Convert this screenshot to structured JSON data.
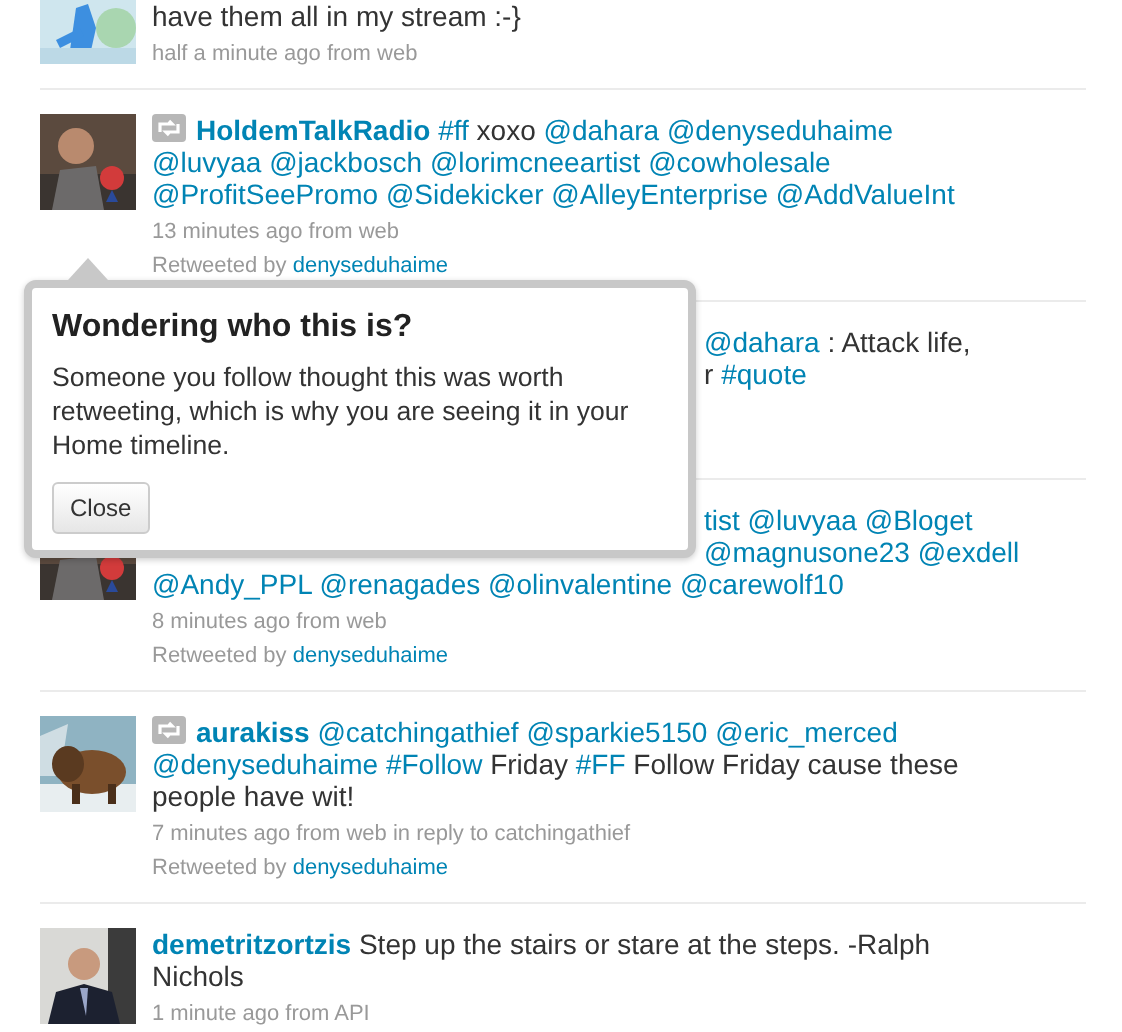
{
  "tweets": [
    {
      "kind": "full",
      "avatar": {
        "kind": "picture",
        "cut_top": true
      },
      "retweet": false,
      "segments": [
        {
          "kind": "plain",
          "text": "have them all in my stream :-}"
        }
      ],
      "meta": "half a minute ago from web"
    },
    {
      "kind": "full",
      "avatar": {
        "kind": "picture"
      },
      "retweet": true,
      "segments": [
        {
          "kind": "user",
          "text": "HoldemTalkRadio"
        },
        {
          "kind": "hashtag",
          "text": "#ff"
        },
        {
          "kind": "plain",
          "text": "xoxo"
        },
        {
          "kind": "mention",
          "text": "@dahara"
        },
        {
          "kind": "mention",
          "text": "@denyseduhaime"
        },
        {
          "kind": "mention",
          "text": "@luvyaa"
        },
        {
          "kind": "mention",
          "text": "@jackbosch"
        },
        {
          "kind": "mention",
          "text": "@lorimcneeartist"
        },
        {
          "kind": "mention",
          "text": "@cowholesale"
        },
        {
          "kind": "mention",
          "text": "@ProfitSeePromo"
        },
        {
          "kind": "mention",
          "text": "@Sidekicker"
        },
        {
          "kind": "mention",
          "text": "@AlleyEnterprise"
        },
        {
          "kind": "mention",
          "text": "@AddValueInt"
        }
      ],
      "meta": "13 minutes ago from web",
      "retweeted_by": {
        "label": "Retweeted by",
        "user": "denyseduhaime"
      }
    },
    {
      "kind": "obscured",
      "lines": [
        {
          "kind": "clipped",
          "segments": [
            {
              "kind": "mention",
              "text": "@dahara"
            },
            {
              "kind": "plain",
              "text": ": Attack life,"
            }
          ]
        },
        {
          "kind": "clipped",
          "segments": [
            {
              "kind": "plain",
              "text": "r"
            },
            {
              "kind": "hashtag",
              "text": "#quote"
            }
          ]
        }
      ]
    },
    {
      "kind": "obscured",
      "avatar": {
        "kind": "picture"
      },
      "lines": [
        {
          "kind": "clipped",
          "segments": [
            {
              "kind": "mention",
              "text": "tist"
            },
            {
              "kind": "mention",
              "text": "@luvyaa"
            },
            {
              "kind": "mention",
              "text": "@Bloget"
            }
          ]
        },
        {
          "kind": "clipped",
          "segments": [
            {
              "kind": "mention",
              "text": "@magnusone23"
            },
            {
              "kind": "mention",
              "text": "@exdell"
            }
          ]
        },
        {
          "kind": "whole",
          "segments": [
            {
              "kind": "mention",
              "text": "@Andy_PPL"
            },
            {
              "kind": "mention",
              "text": "@renagades"
            },
            {
              "kind": "mention",
              "text": "@olinvalentine"
            },
            {
              "kind": "mention",
              "text": "@carewolf10"
            }
          ]
        }
      ],
      "meta": "8 minutes ago from web",
      "retweeted_by": {
        "label": "Retweeted by",
        "user": "denyseduhaime"
      }
    },
    {
      "kind": "full",
      "avatar": {
        "kind": "picture"
      },
      "retweet": true,
      "segments": [
        {
          "kind": "user",
          "text": "aurakiss"
        },
        {
          "kind": "mention",
          "text": "@catchingathief"
        },
        {
          "kind": "mention",
          "text": "@sparkie5150"
        },
        {
          "kind": "mention",
          "text": "@eric_merced"
        },
        {
          "kind": "mention",
          "text": "@denyseduhaime"
        },
        {
          "kind": "hashtag",
          "text": "#Follow"
        },
        {
          "kind": "plain",
          "text": "Friday"
        },
        {
          "kind": "hashtag",
          "text": "#FF"
        },
        {
          "kind": "plain",
          "text": "Follow Friday cause these people have wit!"
        }
      ],
      "meta": "7 minutes ago from web in reply to catchingathief",
      "retweeted_by": {
        "label": "Retweeted by",
        "user": "denyseduhaime"
      }
    },
    {
      "kind": "full",
      "avatar": {
        "kind": "picture"
      },
      "retweet": false,
      "segments": [
        {
          "kind": "user",
          "text": "demetritzortzis"
        },
        {
          "kind": "plain",
          "text": "Step up the stairs or stare at the steps. -Ralph Nichols"
        }
      ],
      "meta": "1 minute ago from API"
    }
  ],
  "popup": {
    "title": "Wondering who this is?",
    "body": "Someone you follow thought this was worth retweeting, which is why you are seeing it in your Home timeline.",
    "button": "Close"
  }
}
